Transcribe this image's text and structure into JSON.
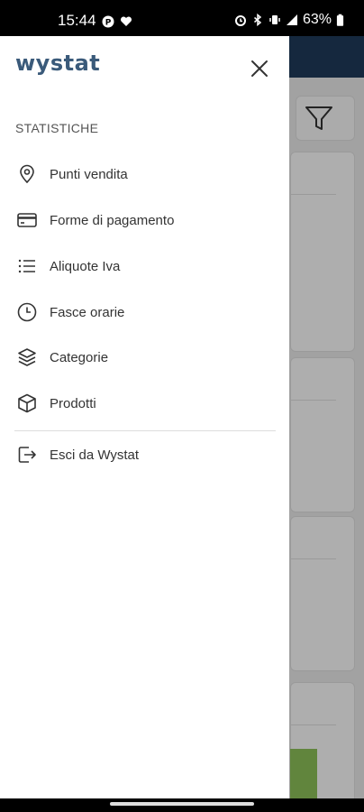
{
  "status_bar": {
    "time": "15:44",
    "battery": "63%"
  },
  "drawer": {
    "logo": "wystat",
    "section_title": "STATISTICHE",
    "items": [
      {
        "label": "Punti vendita",
        "icon": "map-pin-icon"
      },
      {
        "label": "Forme di pagamento",
        "icon": "credit-card-icon"
      },
      {
        "label": "Aliquote Iva",
        "icon": "list-icon"
      },
      {
        "label": "Fasce orarie",
        "icon": "clock-icon"
      },
      {
        "label": "Categorie",
        "icon": "layers-icon"
      },
      {
        "label": "Prodotti",
        "icon": "box-icon"
      }
    ],
    "logout_label": "Esci da Wystat"
  },
  "colors": {
    "brand": "#3a5a7a",
    "header": "#1f3a5a",
    "chart_bar": "#8bbf58"
  }
}
